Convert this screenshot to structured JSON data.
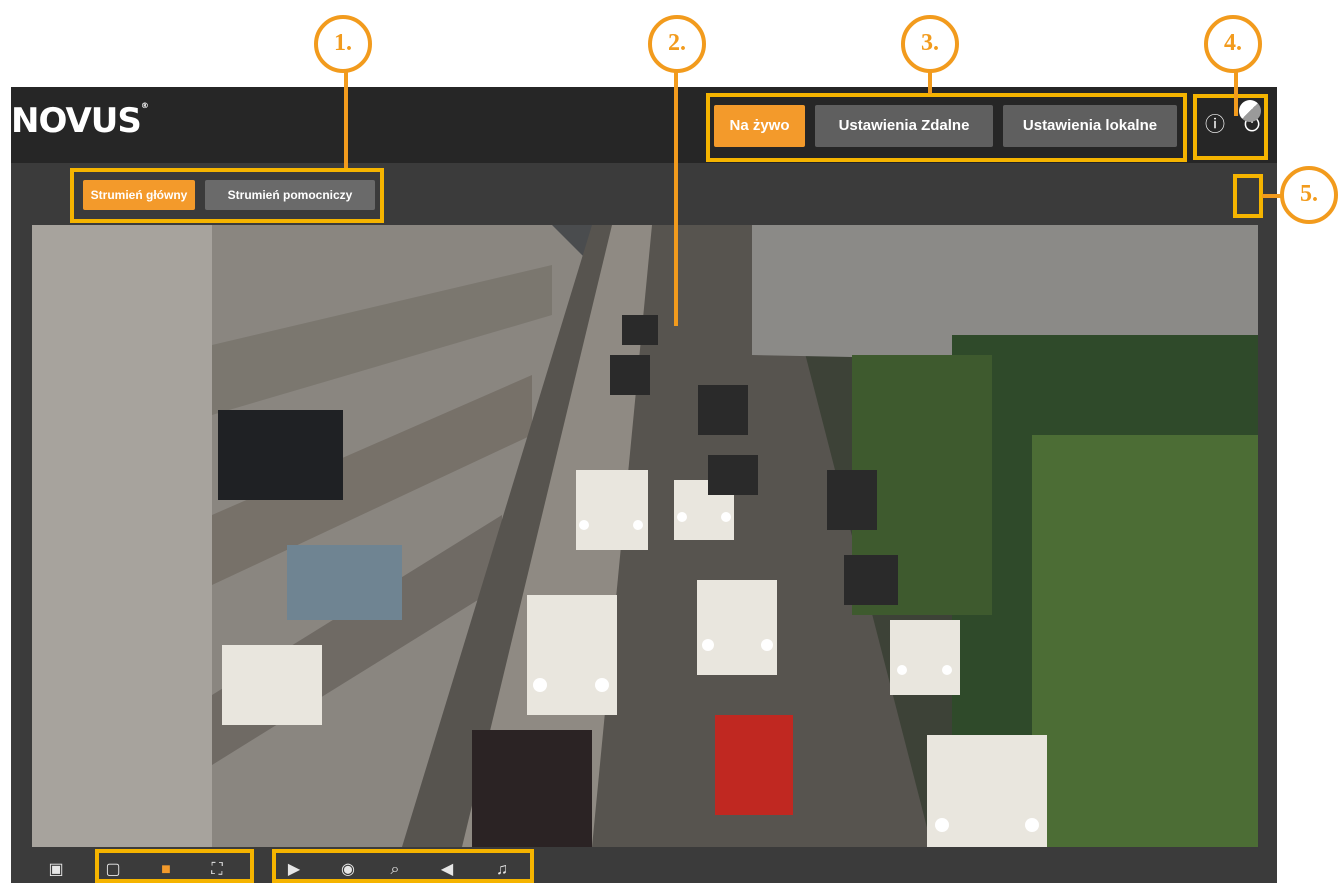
{
  "app": {
    "logo": "NOVUS",
    "logo_mark": "®",
    "top_nav": [
      "Na żywo",
      "Ustawienia Zdalne",
      "Ustawienia lokalne"
    ],
    "top_icons": [
      "info-icon",
      "power-icon"
    ],
    "streams": [
      "Strumień główny",
      "Strumień pomocniczy"
    ],
    "right_tool": "white-balance-icon",
    "bottom_icons": [
      "view-single-icon",
      "view-original-icon",
      "view-fit-icon",
      "view-fullscreen-icon",
      "record-icon",
      "snapshot-icon",
      "zoom-icon",
      "audio-mute-icon",
      "microphone-icon"
    ]
  },
  "callouts": [
    "1.",
    "2.",
    "3.",
    "4.",
    "5."
  ],
  "colors": {
    "accent": "#f39a2b",
    "callout": "#f29b1d",
    "highlight": "#f5b400",
    "topbar": "#262626",
    "body": "#3b3b3b"
  }
}
